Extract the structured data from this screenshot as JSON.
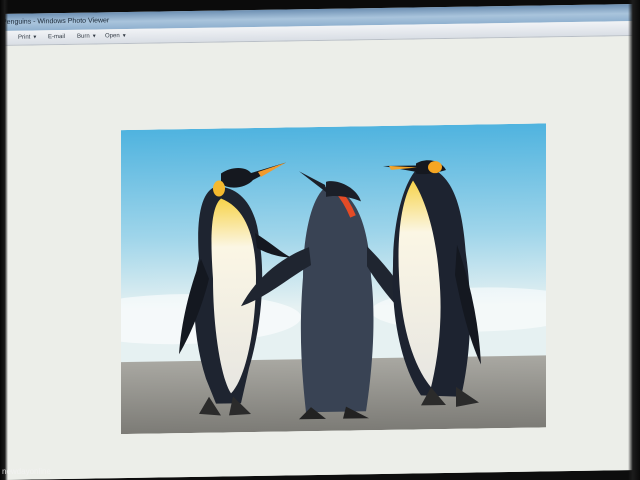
{
  "window": {
    "title": "Penguins - Windows Photo Viewer"
  },
  "toolbar": {
    "items": [
      {
        "label": "Print",
        "has_menu": true
      },
      {
        "label": "E-mail",
        "has_menu": false
      },
      {
        "label": "Burn",
        "has_menu": true
      },
      {
        "label": "Open",
        "has_menu": true
      }
    ],
    "dropdown_icon": "chevron-down-icon"
  },
  "viewer": {
    "image_subject": "three king penguins on a beach",
    "background_color": "#eceee9"
  },
  "watermark": {
    "text": "newdayonline"
  },
  "colors": {
    "titlebar": "#8fb0cf",
    "sky": "#6fc3e3",
    "sand": "#9b9b96"
  }
}
